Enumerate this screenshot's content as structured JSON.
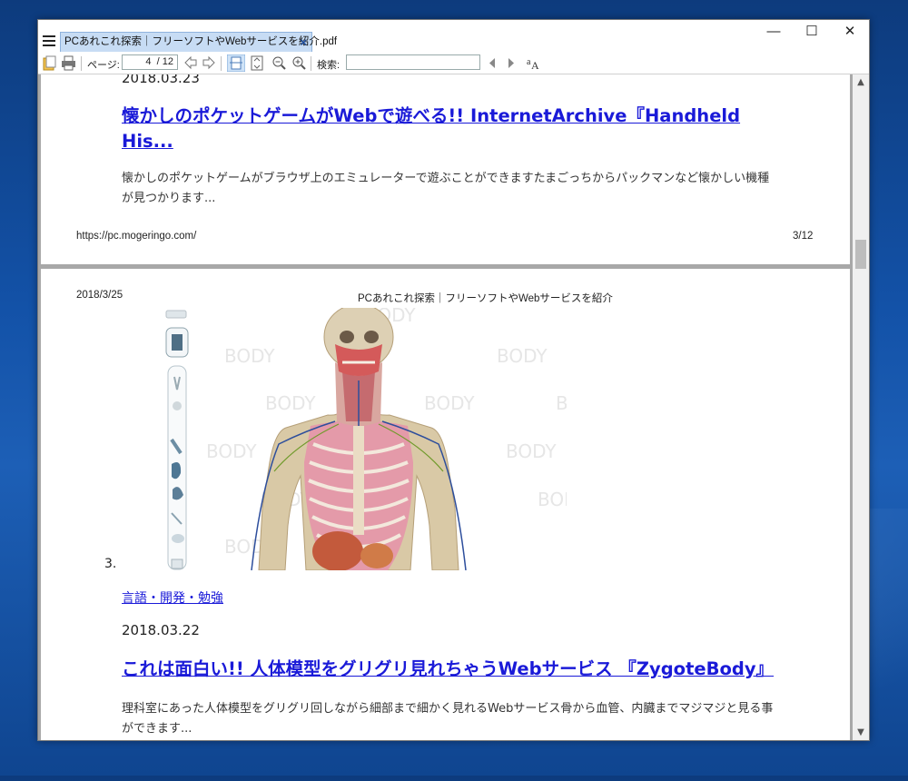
{
  "window": {
    "tab_title": "PCあれこれ探索｜フリーソフトやWebサービスを紹介.pdf",
    "tab_close": "×",
    "controls": {
      "minimize": "—",
      "maximize": "☐",
      "close": "✕"
    }
  },
  "toolbar": {
    "page_label": "ページ:",
    "page_current": "4",
    "page_total": "/ 12",
    "search_label": "検索:",
    "search_value": ""
  },
  "page1": {
    "date": "2018.03.23",
    "headline_line1": "懐かしのポケットゲームがWebで遊べる!! InternetArchive『Handheld",
    "headline_line2": "His...",
    "desc_line1": "懐かしのポケットゲームがブラウザ上のエミュレーターで遊ぶことができますたまごっちからパックマンなど懐かしい機種",
    "desc_line2": "が見つかります...",
    "footer_url": "https://pc.mogeringo.com/",
    "footer_page": "3/12"
  },
  "page2": {
    "header_date": "2018/3/25",
    "header_title": "PCあれこれ探索｜フリーソフトやWebサービスを紹介",
    "figure_watermark": "BODY",
    "list_number": "3.",
    "category": "言語・開発・勉強",
    "date": "2018.03.22",
    "headline": "これは面白い!! 人体模型をグリグリ見れちゃうWebサービス 『ZygoteBody』",
    "desc_line1": "理科室にあった人体模型をグリグリ回しながら細部まで細かく見れるWebサービス骨から血管、内臓までマジマジと見る事",
    "desc_line2": "ができます..."
  },
  "scrollbar": {
    "up": "▲",
    "down": "▼"
  },
  "colors": {
    "link": "#1a1ad8",
    "tab_bg": "#c7dcf4",
    "viewer_bg": "#a8a8a8"
  }
}
